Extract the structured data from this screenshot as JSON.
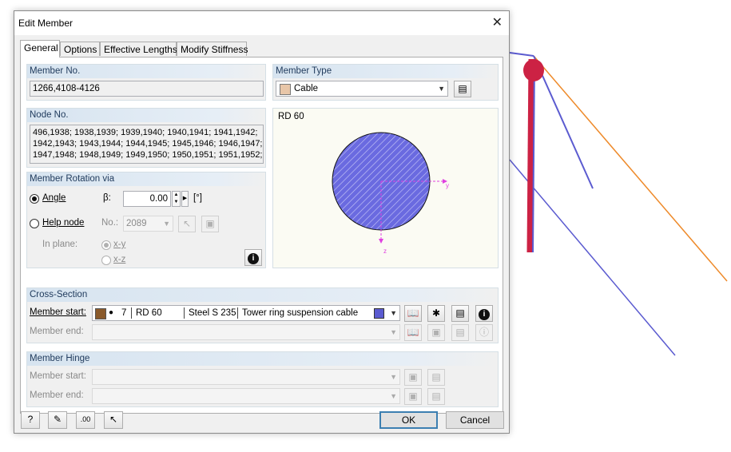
{
  "colors": {
    "cable_blue": "#5b5bd0",
    "cable_orange": "#ee8a2a",
    "tower_red": "#cc2244",
    "brown_swatch": "#8a5a2b",
    "type_swatch": "#e8c6a8"
  },
  "dialog": {
    "title": "Edit Member",
    "tabs": [
      "General",
      "Options",
      "Effective Lengths",
      "Modify Stiffness"
    ],
    "member_no": {
      "label": "Member No.",
      "value": "1266,4108-4126"
    },
    "member_type": {
      "label": "Member Type",
      "value": "Cable"
    },
    "node_no": {
      "label": "Node No.",
      "lines": [
        "496,1938; 1938,1939; 1939,1940; 1940,1941; 1941,1942;",
        "1942,1943; 1943,1944; 1944,1945; 1945,1946; 1946,1947;",
        "1947,1948; 1948,1949; 1949,1950; 1950,1951; 1951,1952;"
      ]
    },
    "rotation": {
      "title": "Member Rotation via",
      "angle_label": "Angle",
      "beta_label": "β:",
      "beta_value": "0.00",
      "unit": "[°]",
      "help_node_label": "Help node",
      "no_label": "No.:",
      "no_value": "2089",
      "in_plane_label": "In plane:",
      "plane_xy": "x-y",
      "plane_xz": "x-z"
    },
    "preview": {
      "section_name": "RD 60",
      "axis_y": "y",
      "axis_z": "z"
    },
    "cross_section": {
      "title": "Cross-Section",
      "start_label": "Member start:",
      "start_number": "7",
      "start_section": "RD 60",
      "start_material": "Steel S 235",
      "start_description": "Tower ring suspension cable",
      "end_label": "Member end:"
    },
    "hinge": {
      "title": "Member Hinge",
      "start_label": "Member start:",
      "end_label": "Member end:"
    },
    "buttons": {
      "ok": "OK",
      "cancel": "Cancel"
    }
  }
}
